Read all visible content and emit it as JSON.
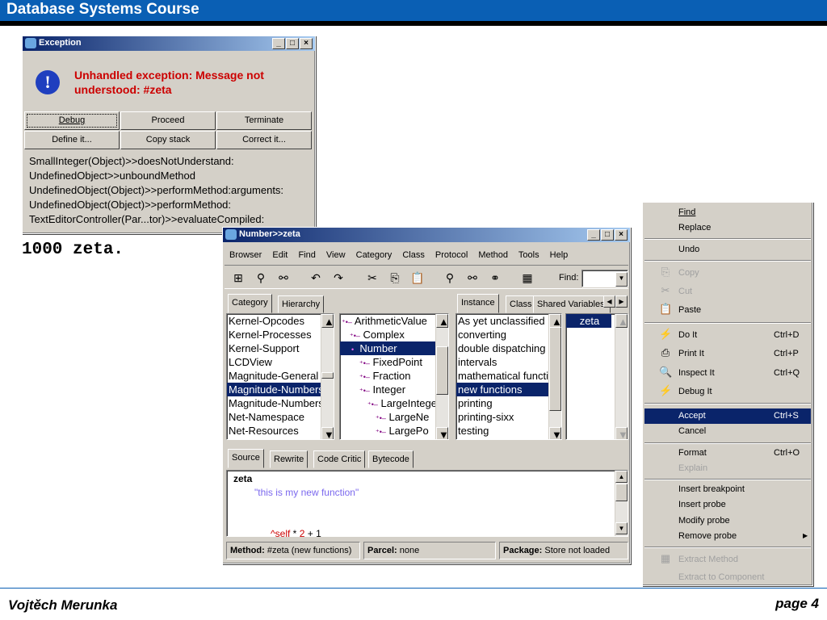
{
  "slide": {
    "title": "Database Systems Course",
    "code": "1000 zeta.",
    "author": "Vojtěch Merunka",
    "page": "page 4"
  },
  "exception_window": {
    "title": "Exception",
    "message_line1": "Unhandled exception: Message not",
    "message_line2": "understood: #zeta",
    "buttons": [
      "Debug",
      "Proceed",
      "Terminate",
      "Define it...",
      "Copy stack",
      "Correct it..."
    ],
    "stack": [
      "SmallInteger(Object)>>doesNotUnderstand:",
      "UndefinedObject>>unboundMethod",
      "UndefinedObject(Object)>>performMethod:arguments:",
      "UndefinedObject(Object)>>performMethod:",
      "TextEditorController(Par...tor)>>evaluateCompiled:"
    ]
  },
  "browser_window": {
    "title": "Number>>zeta",
    "menu": [
      "Browser",
      "Edit",
      "Find",
      "View",
      "Category",
      "Class",
      "Protocol",
      "Method",
      "Tools",
      "Help"
    ],
    "find_label": "Find:",
    "left_tabs": [
      "Category",
      "Hierarchy"
    ],
    "right_tabs": [
      "Instance",
      "Class",
      "Shared Variables"
    ],
    "categories": [
      "Kernel-Opcodes",
      "Kernel-Processes",
      "Kernel-Support",
      "LCDView",
      "Magnitude-General",
      "Magnitude-Numbers",
      "Magnitude-Numbers",
      "Net-Namespace",
      "Net-Resources"
    ],
    "classes": [
      "ArithmeticValue",
      "Complex",
      "Number",
      "FixedPoint",
      "Fraction",
      "Integer",
      "LargeInteger",
      "LargeNe",
      "LargePo"
    ],
    "protocols": [
      "As yet unclassified",
      "converting",
      "double dispatching",
      "intervals",
      "mathematical functions",
      "new functions",
      "printing",
      "printing-sixx",
      "testing"
    ],
    "methods": [
      "zeta"
    ],
    "code_tabs": [
      "Source",
      "Rewrite",
      "Code Critic",
      "Bytecode"
    ],
    "code": {
      "line1": "zeta",
      "line2": "\"this is my new function\"",
      "line3_caret": "^",
      "line3_self": "self",
      "line3_op": " * ",
      "line3_num": "2",
      "line3_plus": " + ",
      "line3_one": "1"
    },
    "status": {
      "method_label": "Method:",
      "method_value": "#zeta (new functions)",
      "parcel_label": "Parcel:",
      "parcel_value": "none",
      "package_label": "Package:",
      "package_value": "Store not loaded"
    }
  },
  "context_menu": {
    "items": [
      {
        "label": "Find",
        "shortcut": ""
      },
      {
        "label": "Replace",
        "shortcut": ""
      },
      {
        "label": "Undo",
        "shortcut": ""
      },
      {
        "label": "Copy",
        "shortcut": ""
      },
      {
        "label": "Cut",
        "shortcut": ""
      },
      {
        "label": "Paste",
        "shortcut": ""
      },
      {
        "label": "Do It",
        "shortcut": "Ctrl+D"
      },
      {
        "label": "Print It",
        "shortcut": "Ctrl+P"
      },
      {
        "label": "Inspect It",
        "shortcut": "Ctrl+Q"
      },
      {
        "label": "Debug It",
        "shortcut": ""
      },
      {
        "label": "Accept",
        "shortcut": "Ctrl+S"
      },
      {
        "label": "Cancel",
        "shortcut": ""
      },
      {
        "label": "Format",
        "shortcut": "Ctrl+O"
      },
      {
        "label": "Explain",
        "shortcut": ""
      },
      {
        "label": "Insert breakpoint",
        "shortcut": ""
      },
      {
        "label": "Insert probe",
        "shortcut": ""
      },
      {
        "label": "Modify probe",
        "shortcut": ""
      },
      {
        "label": "Remove probe",
        "shortcut": ""
      },
      {
        "label": "Extract Method",
        "shortcut": ""
      },
      {
        "label": "Extract to Component",
        "shortcut": ""
      }
    ]
  },
  "colors": {
    "slide_blue": "#0a5fb4",
    "selection": "#0a246a",
    "error_red": "#cc0000",
    "code_purple": "#7b68ee"
  }
}
